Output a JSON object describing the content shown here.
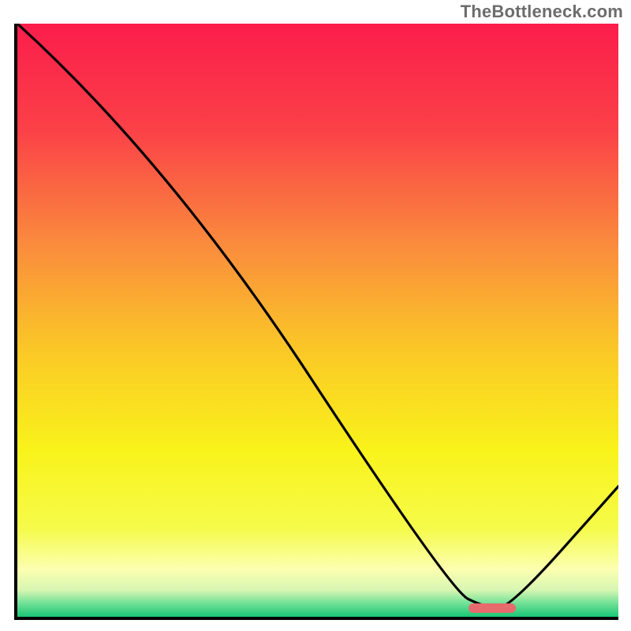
{
  "watermark": "TheBottleneck.com",
  "chart_data": {
    "type": "line",
    "title": "",
    "xlabel": "",
    "ylabel": "",
    "xlim": [
      0,
      100
    ],
    "ylim": [
      0,
      100
    ],
    "grid": false,
    "legend": false,
    "series": [
      {
        "name": "bottleneck-curve",
        "x": [
          0,
          25,
          72,
          78,
          82,
          100
        ],
        "y": [
          100,
          77,
          4.5,
          1.5,
          1.5,
          22
        ],
        "notes": "y is relative bottleneck percentage; curve descends from top-left, slope steepens after x≈25, reaches a flat minimum near x≈78–82, then rises toward the right edge."
      }
    ],
    "optimal_marker": {
      "x_start": 75,
      "x_end": 83,
      "y": 1.5,
      "color": "#e76a6d"
    },
    "background_gradient": {
      "stops": [
        {
          "offset": 0.0,
          "color": "#fb1d4b"
        },
        {
          "offset": 0.18,
          "color": "#fb4148"
        },
        {
          "offset": 0.38,
          "color": "#fa8e3c"
        },
        {
          "offset": 0.55,
          "color": "#fac826"
        },
        {
          "offset": 0.72,
          "color": "#f9f31b"
        },
        {
          "offset": 0.85,
          "color": "#f5fb49"
        },
        {
          "offset": 0.92,
          "color": "#fcffb0"
        },
        {
          "offset": 0.955,
          "color": "#d7f6b2"
        },
        {
          "offset": 0.975,
          "color": "#7be39a"
        },
        {
          "offset": 1.0,
          "color": "#18c775"
        }
      ]
    }
  }
}
